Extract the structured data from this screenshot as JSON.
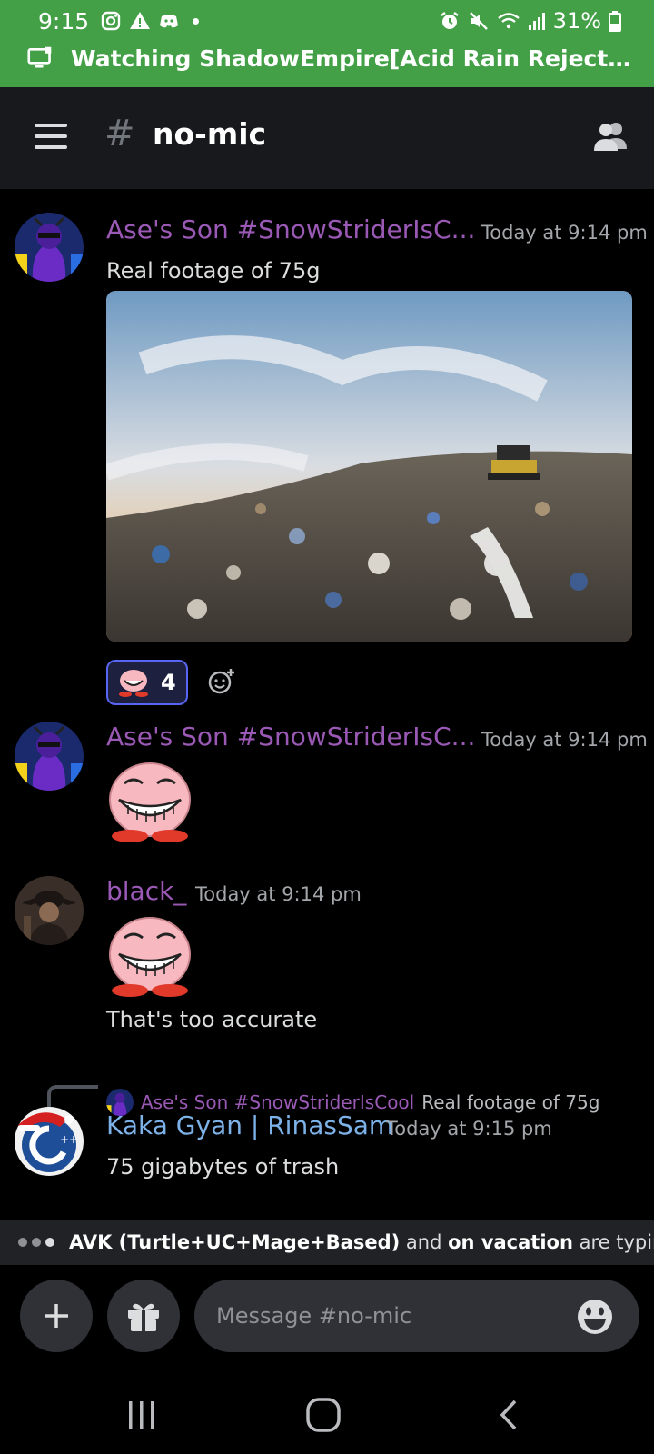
{
  "status_bar": {
    "time": "9:15",
    "battery": "31%",
    "watching_text": "Watching ShadowEmpire[Acid Rain Rejector]'s S..."
  },
  "header": {
    "hash": "#",
    "channel_name": "no-mic"
  },
  "messages": [
    {
      "author": "Ase's Son #SnowStriderIsC...",
      "timestamp": "Today at 9:14 pm",
      "text": "Real footage of 75g",
      "reaction_count": "4"
    },
    {
      "author": "Ase's Son #SnowStriderIsC...",
      "timestamp": "Today at 9:14 pm"
    },
    {
      "author": "black_",
      "timestamp": "Today at 9:14 pm",
      "text": "That's too accurate"
    },
    {
      "reply_author": "Ase's Son #SnowStriderIsCool",
      "reply_text": "Real footage of 75g",
      "author": "Kaka Gyan | RinasSam",
      "timestamp": "Today at 9:15 pm",
      "text": "75 gigabytes of trash"
    }
  ],
  "typing": {
    "user1": "AVK (Turtle+UC+Mage+Based)",
    "and": "and",
    "user2": "on vacation",
    "suffix": "are typing..."
  },
  "composer": {
    "placeholder": "Message #no-mic"
  },
  "colors": {
    "status_bar": "#43a047",
    "header": "#18191c",
    "author_purple": "#9b59b6",
    "author_blue": "#7cb2e8",
    "accent": "#5865f2"
  }
}
